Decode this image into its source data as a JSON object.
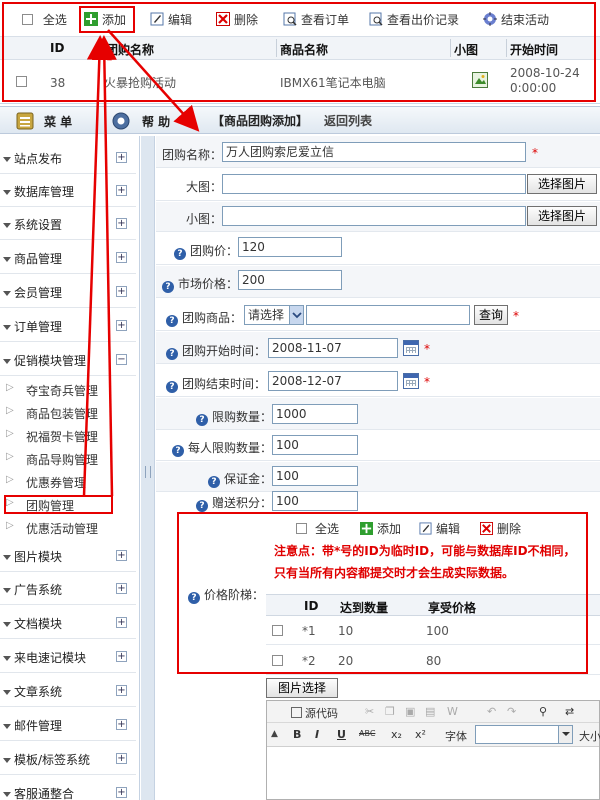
{
  "top_toolbar": {
    "select_all": "全选",
    "add": "添加",
    "edit": "编辑",
    "delete": "删除",
    "view_orders": "查看订单",
    "view_bids": "查看出价记录",
    "end_activity": "结束活动"
  },
  "list": {
    "columns": [
      "ID",
      "团购名称",
      "商品名称",
      "小图",
      "开始时间"
    ],
    "rows": [
      {
        "id": "38",
        "group_name": "火暴抢购活动",
        "product_name": "IBMX61笔记本电脑",
        "start_time": "2008-10-24 0:00:00"
      }
    ]
  },
  "nav": {
    "menu": "菜 单",
    "help": "帮 助",
    "page_title": "【商品团购添加】",
    "back": "返回列表"
  },
  "sidebar": {
    "items": [
      {
        "label": "站点发布",
        "toggle": "+"
      },
      {
        "label": "数据库管理",
        "toggle": "+"
      },
      {
        "label": "系统设置",
        "toggle": "+"
      },
      {
        "label": "商品管理",
        "toggle": "+"
      },
      {
        "label": "会员管理",
        "toggle": "+"
      },
      {
        "label": "订单管理",
        "toggle": "+"
      },
      {
        "label": "促销模块管理",
        "toggle": "−"
      }
    ],
    "sub_items": [
      "夺宝奇兵管理",
      "商品包装管理",
      "祝福贺卡管理",
      "商品导购管理",
      "优惠券管理",
      "团购管理",
      "优惠活动管理"
    ],
    "bottom_items": [
      {
        "label": "图片模块",
        "toggle": "+"
      },
      {
        "label": "广告系统",
        "toggle": "+"
      },
      {
        "label": "文档模块",
        "toggle": "+"
      },
      {
        "label": "来电速记模块",
        "toggle": "+"
      },
      {
        "label": "文章系统",
        "toggle": "+"
      },
      {
        "label": "邮件管理",
        "toggle": "+"
      },
      {
        "label": "模板/标签系统",
        "toggle": "+"
      },
      {
        "label": "客服通整合",
        "toggle": "+"
      }
    ]
  },
  "form": {
    "group_name_label": "团购名称：",
    "group_name_value": "万人团购索尼爱立信",
    "big_image_label": "大图：",
    "small_image_label": "小图：",
    "choose_image": "选择图片",
    "group_price_label": "团购价：",
    "group_price_value": "120",
    "market_price_label": "市场价格：",
    "market_price_value": "200",
    "product_label": "团购商品：",
    "product_select": "请选择",
    "query": "查询",
    "start_label": "团购开始时间：",
    "start_value": "2008-11-07",
    "end_label": "团购结束时间：",
    "end_value": "2008-12-07",
    "limit_label": "限购数量：",
    "limit_value": "1000",
    "per_person_label": "每人限购数量：",
    "per_person_value": "100",
    "deposit_label": "保证金：",
    "deposit_value": "100",
    "points_label": "赠送积分：",
    "points_value": "100",
    "tier_label": "价格阶梯：",
    "required_mark": "*",
    "help_mark": "?"
  },
  "tier": {
    "select_all": "全选",
    "add": "添加",
    "edit": "编辑",
    "delete": "删除",
    "note_line1": "注意点：带*号的ID为临时ID，可能与数据库ID不相同，",
    "note_line2": "只有当所有内容都提交时才会生成实际数据。",
    "columns": [
      "ID",
      "达到数量",
      "享受价格"
    ],
    "rows": [
      {
        "id": "*1",
        "qty": "10",
        "price": "100"
      },
      {
        "id": "*2",
        "qty": "20",
        "price": "80"
      }
    ]
  },
  "editor": {
    "image_select": "图片选择",
    "source": "源代码",
    "font_label": "字体",
    "size_label": "大小",
    "bold": "B",
    "italic": "I",
    "underline": "U",
    "strike": "ABC",
    "sub": "x₂",
    "sup": "x²"
  },
  "colors": {
    "annotation": "#e60000",
    "link_blue": "#2f5fa8",
    "border": "#7f9db9"
  }
}
